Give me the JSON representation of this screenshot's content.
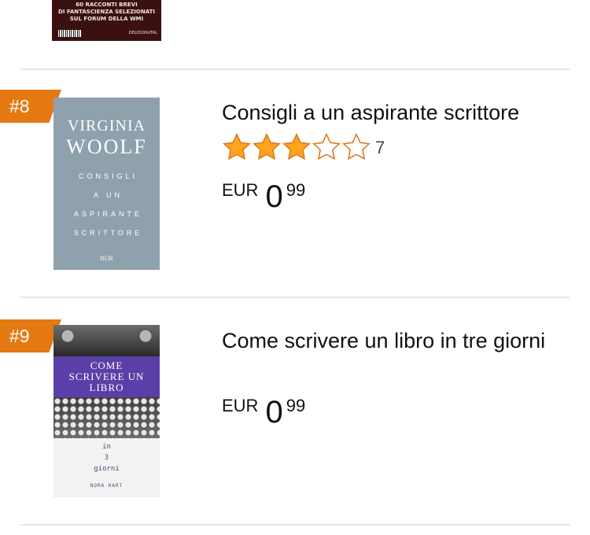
{
  "previous_item": {
    "cover_lines": [
      "60 RACCONTI BREVI",
      "DI FANTASCIENZA SELEZIONATI",
      "SUL FORUM DELLA WMI"
    ],
    "cover_imprint": "DELOSDIGITAL"
  },
  "items": [
    {
      "rank": "#8",
      "title": "Consigli a un aspirante scrittore",
      "rating_value": 3,
      "rating_max": 5,
      "rating_count": "7",
      "currency": "EUR",
      "price_whole": "0",
      "price_fraction": "99",
      "cover": {
        "author_line1": "VIRGINIA",
        "author_line2": "WOOLF",
        "title_lines": [
          "CONSIGLI",
          "A UN",
          "ASPIRANTE",
          "SCRITTORE"
        ],
        "publisher": "BUR",
        "bg_color": "#8ea1ad"
      }
    },
    {
      "rank": "#9",
      "title": "Come scrivere un libro in tre giorni",
      "currency": "EUR",
      "price_whole": "0",
      "price_fraction": "99",
      "cover": {
        "title_lines": [
          "COME",
          "SCRIVERE UN",
          "LIBRO"
        ],
        "subtitle_lines": [
          "in",
          "3",
          "giorni"
        ],
        "author": "NORA HART",
        "band_color": "#5b3fa8"
      }
    }
  ],
  "colors": {
    "rank_badge": "#e47911",
    "star_fill": "#ffa41c",
    "star_outline": "#de7921",
    "divider": "#e7e7e7"
  },
  "icons": {
    "star_full": "star-filled-icon",
    "star_empty": "star-empty-icon"
  }
}
